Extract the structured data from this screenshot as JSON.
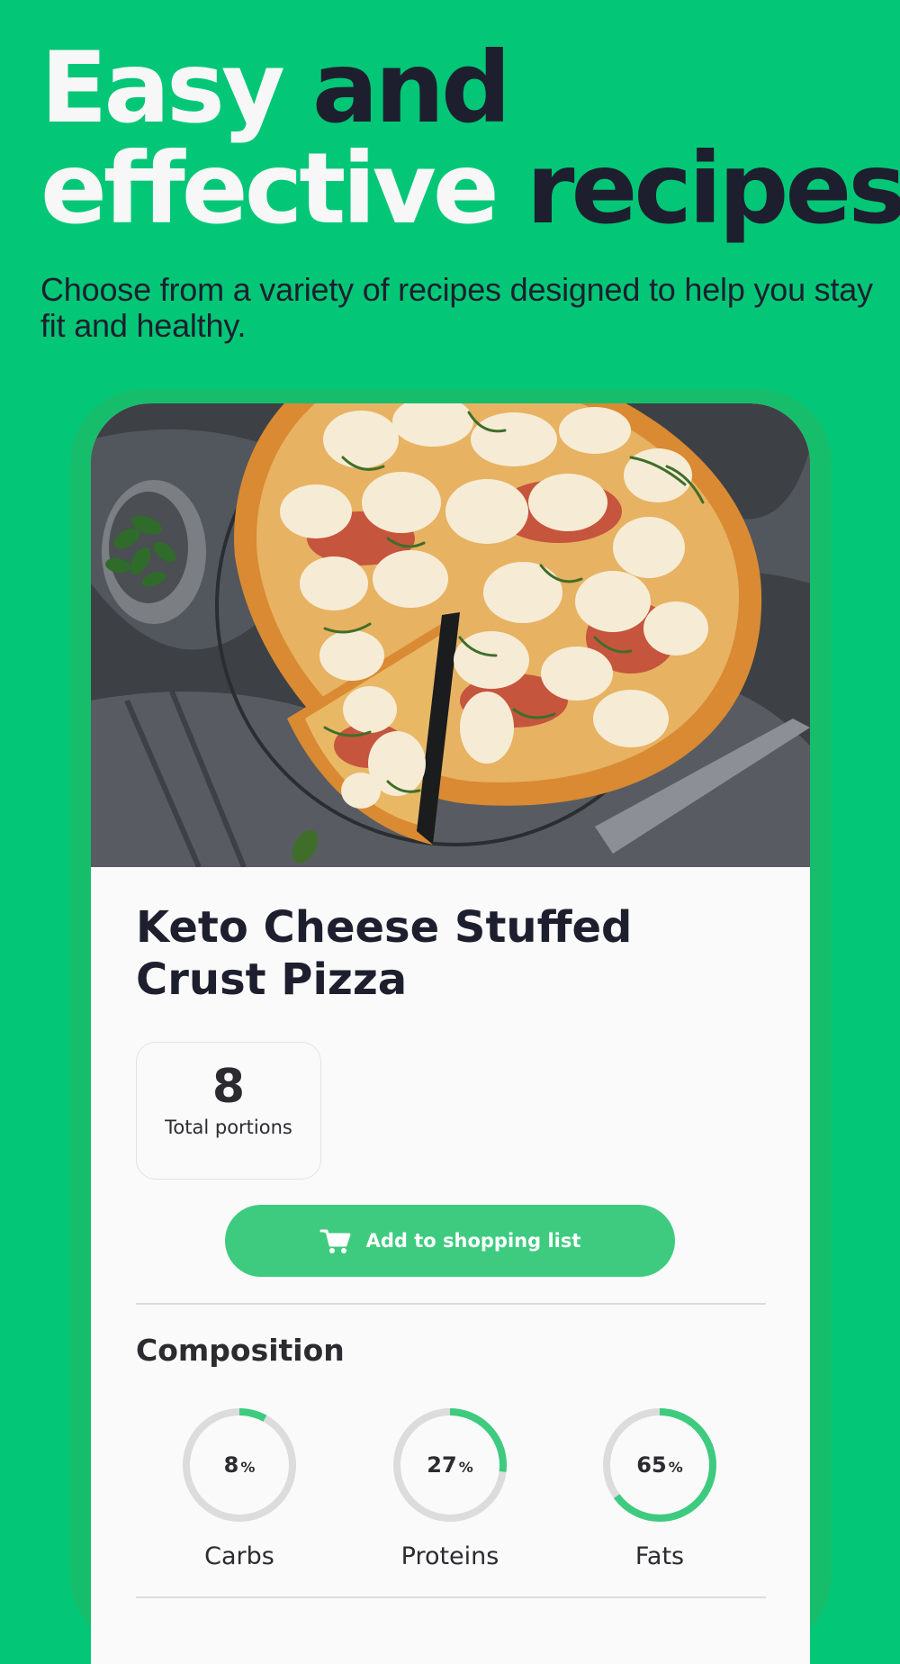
{
  "colors": {
    "background": "#03c777",
    "accent": "#3ecb7f",
    "dark_text": "#1e1f2e",
    "light_text": "#f7f7f7",
    "ring_track": "#dcdcdc"
  },
  "headline": {
    "line1_light": "Easy",
    "line1_dark": "and",
    "line2_light": "effective",
    "line2_dark": "recipes"
  },
  "subtitle": "Choose from a variety of recipes designed to help you stay fit and healthy.",
  "recipe": {
    "image_icon": "pizza-photo",
    "title": "Keto Cheese Stuffed Crust Pizza",
    "portions": {
      "value": "8",
      "label": "Total portions"
    },
    "add_button": {
      "icon": "cart-icon",
      "label": "Add to shopping list"
    }
  },
  "composition": {
    "title": "Composition",
    "macros": [
      {
        "name": "Carbs",
        "value": "8",
        "unit": "%",
        "fraction": 0.08
      },
      {
        "name": "Proteins",
        "value": "27",
        "unit": "%",
        "fraction": 0.27
      },
      {
        "name": "Fats",
        "value": "65",
        "unit": "%",
        "fraction": 0.65
      }
    ]
  }
}
